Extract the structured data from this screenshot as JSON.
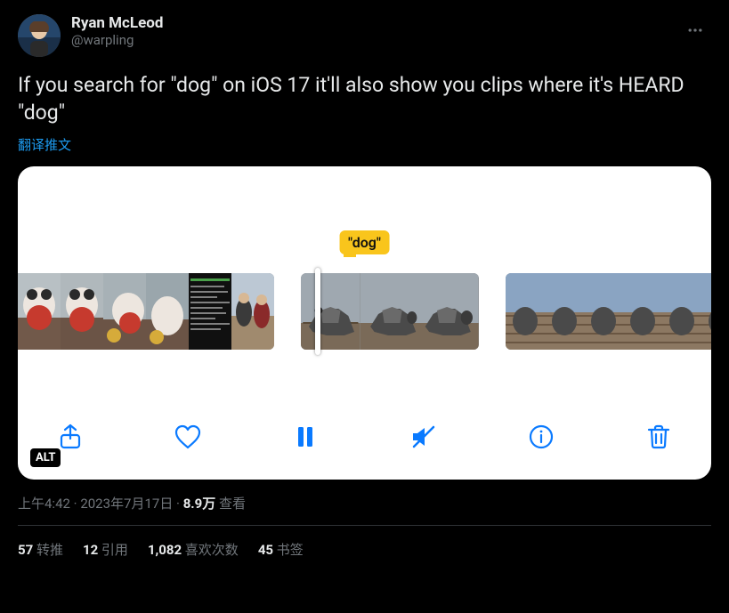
{
  "author": {
    "display_name": "Ryan McLeod",
    "handle": "@warpling"
  },
  "tweet_text": "If you search for \"dog\" on iOS 17 it'll also show you clips where it's HEARD \"dog\"",
  "translate_label": "翻译推文",
  "media": {
    "search_term": "\"dog\"",
    "alt_label": "ALT",
    "toolbar": {
      "share": "share",
      "like": "like",
      "playpause": "pause",
      "mute": "mute",
      "info": "info",
      "delete": "delete"
    }
  },
  "timestamp": {
    "time": "上午4:42",
    "date": "2023年7月17日",
    "views_number": "8.9万",
    "views_label": "查看"
  },
  "stats": {
    "retweets_count": "57",
    "retweets_label": "转推",
    "quotes_count": "12",
    "quotes_label": "引用",
    "likes_count": "1,082",
    "likes_label": "喜欢次数",
    "bookmarks_count": "45",
    "bookmarks_label": "书签"
  }
}
